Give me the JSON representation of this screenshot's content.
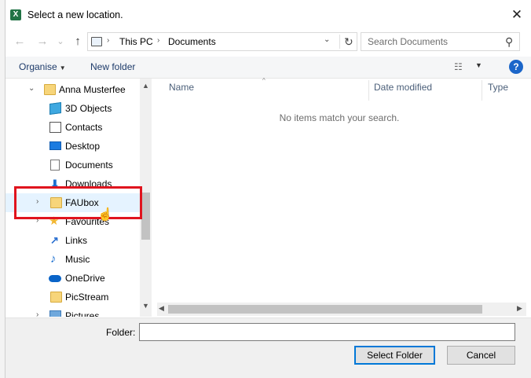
{
  "window": {
    "title": "Select a new location.",
    "app_icon_letter": "X",
    "close_glyph": "✕"
  },
  "nav": {
    "back_glyph": "←",
    "forward_glyph": "→",
    "recent_glyph": "⌄",
    "up_glyph": "↑"
  },
  "address": {
    "crumbs": [
      "This PC",
      "Documents"
    ],
    "sep": "›",
    "dropdown_glyph": "⌄",
    "refresh_glyph": "↻"
  },
  "search": {
    "placeholder": "Search Documents",
    "icon_glyph": "⚲"
  },
  "toolbar": {
    "organise_label": "Organise",
    "new_folder_label": "New folder",
    "caret": "▼",
    "view_glyph": "☷",
    "help_glyph": "?"
  },
  "tree": {
    "items": [
      {
        "label": "Anna Musterfee",
        "chev": "⌄",
        "icon": "folder-icon"
      },
      {
        "label": "3D Objects",
        "chev": "",
        "icon": "cube-icon"
      },
      {
        "label": "Contacts",
        "chev": "",
        "icon": "contacts-icon"
      },
      {
        "label": "Desktop",
        "chev": "",
        "icon": "desktop-icon"
      },
      {
        "label": "Documents",
        "chev": "",
        "icon": "document-icon"
      },
      {
        "label": "Downloads",
        "chev": "",
        "icon": "download-icon"
      },
      {
        "label": "FAUbox",
        "chev": "›",
        "icon": "faubox-folder-icon"
      },
      {
        "label": "Favourites",
        "chev": "›",
        "icon": "star-icon"
      },
      {
        "label": "Links",
        "chev": "",
        "icon": "links-icon"
      },
      {
        "label": "Music",
        "chev": "",
        "icon": "music-icon"
      },
      {
        "label": "OneDrive",
        "chev": "",
        "icon": "cloud-icon"
      },
      {
        "label": "PicStream",
        "chev": "",
        "icon": "folder-icon"
      },
      {
        "label": "Pictures",
        "chev": "›",
        "icon": "pictures-icon"
      }
    ],
    "download_glyph": "⬇",
    "star_glyph": "★",
    "links_glyph": "↗",
    "music_glyph": "♪",
    "scroll_up": "▲",
    "scroll_down": "▼"
  },
  "list": {
    "columns": [
      "Name",
      "Date modified",
      "Type"
    ],
    "sort_glyph": "^",
    "empty_message": "No items match your search.",
    "scroll_left": "◀",
    "scroll_right": "▶"
  },
  "footer": {
    "folder_label": "Folder:",
    "folder_value": "",
    "select_button": "Select Folder",
    "cancel_button": "Cancel"
  },
  "cursor_glyph": "☝",
  "colors": {
    "accent": "#0078d7",
    "highlight": "#e0141e",
    "help": "#1b66c9"
  }
}
